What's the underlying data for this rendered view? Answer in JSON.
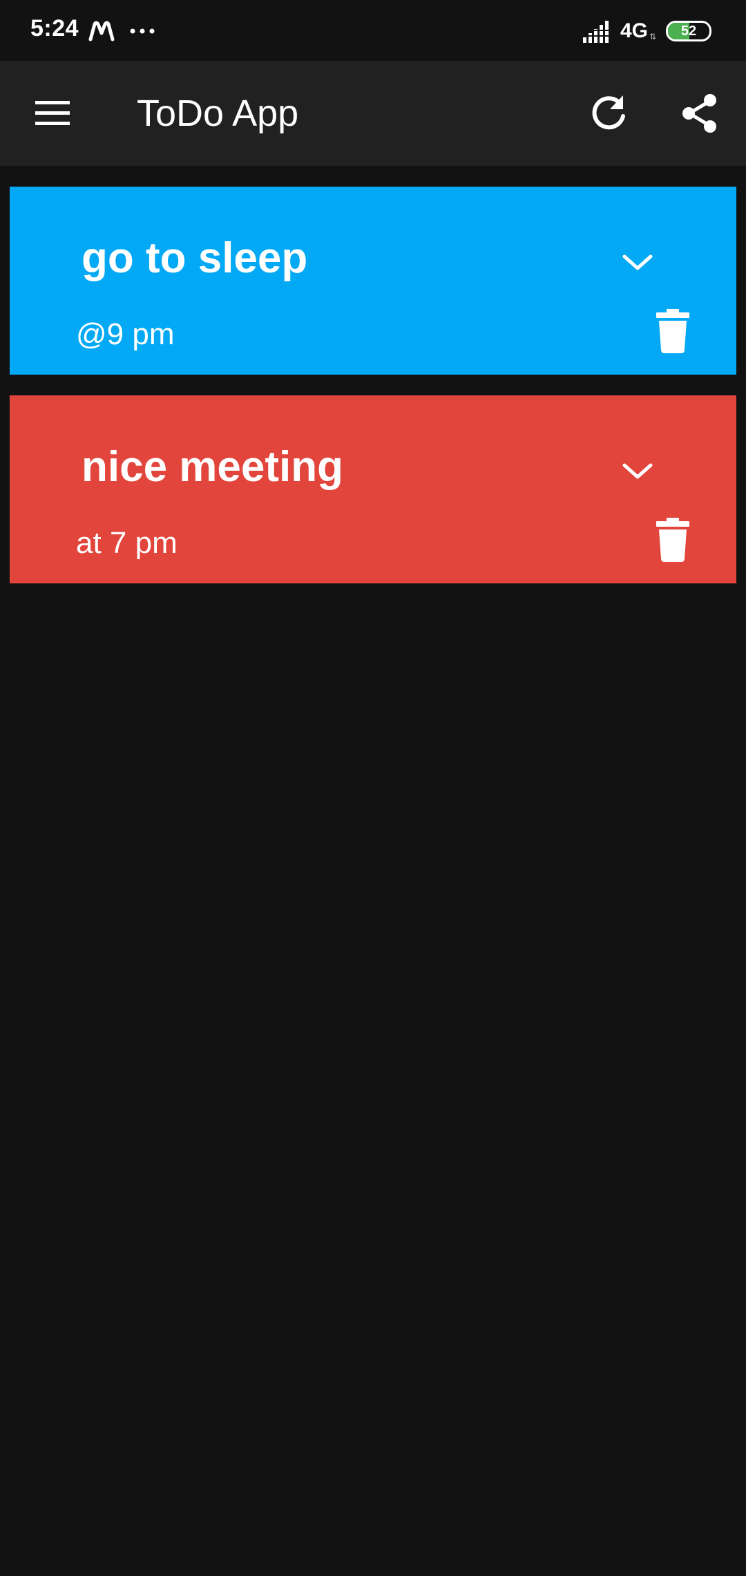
{
  "status_bar": {
    "time": "5:24",
    "network": "4G",
    "battery_level": "52",
    "battery_fraction": 0.52,
    "battery_color": "#4caf50",
    "icons": [
      "m-notification-icon",
      "more-dots-icon",
      "signal-icon",
      "battery-icon"
    ]
  },
  "app_bar": {
    "title": "ToDo App",
    "background": "#212121",
    "icons": [
      "menu-icon",
      "refresh-icon",
      "share-icon"
    ]
  },
  "todos": [
    {
      "title": "go to sleep",
      "description": "@9 pm",
      "color": "#03a9f4",
      "icons": [
        "chevron-down-icon",
        "trash-icon"
      ]
    },
    {
      "title": "nice meeting",
      "description": "at 7 pm",
      "color": "#e2453b",
      "icons": [
        "chevron-down-icon",
        "trash-icon"
      ]
    }
  ],
  "theme": {
    "background": "#121212",
    "text": "#ffffff"
  }
}
